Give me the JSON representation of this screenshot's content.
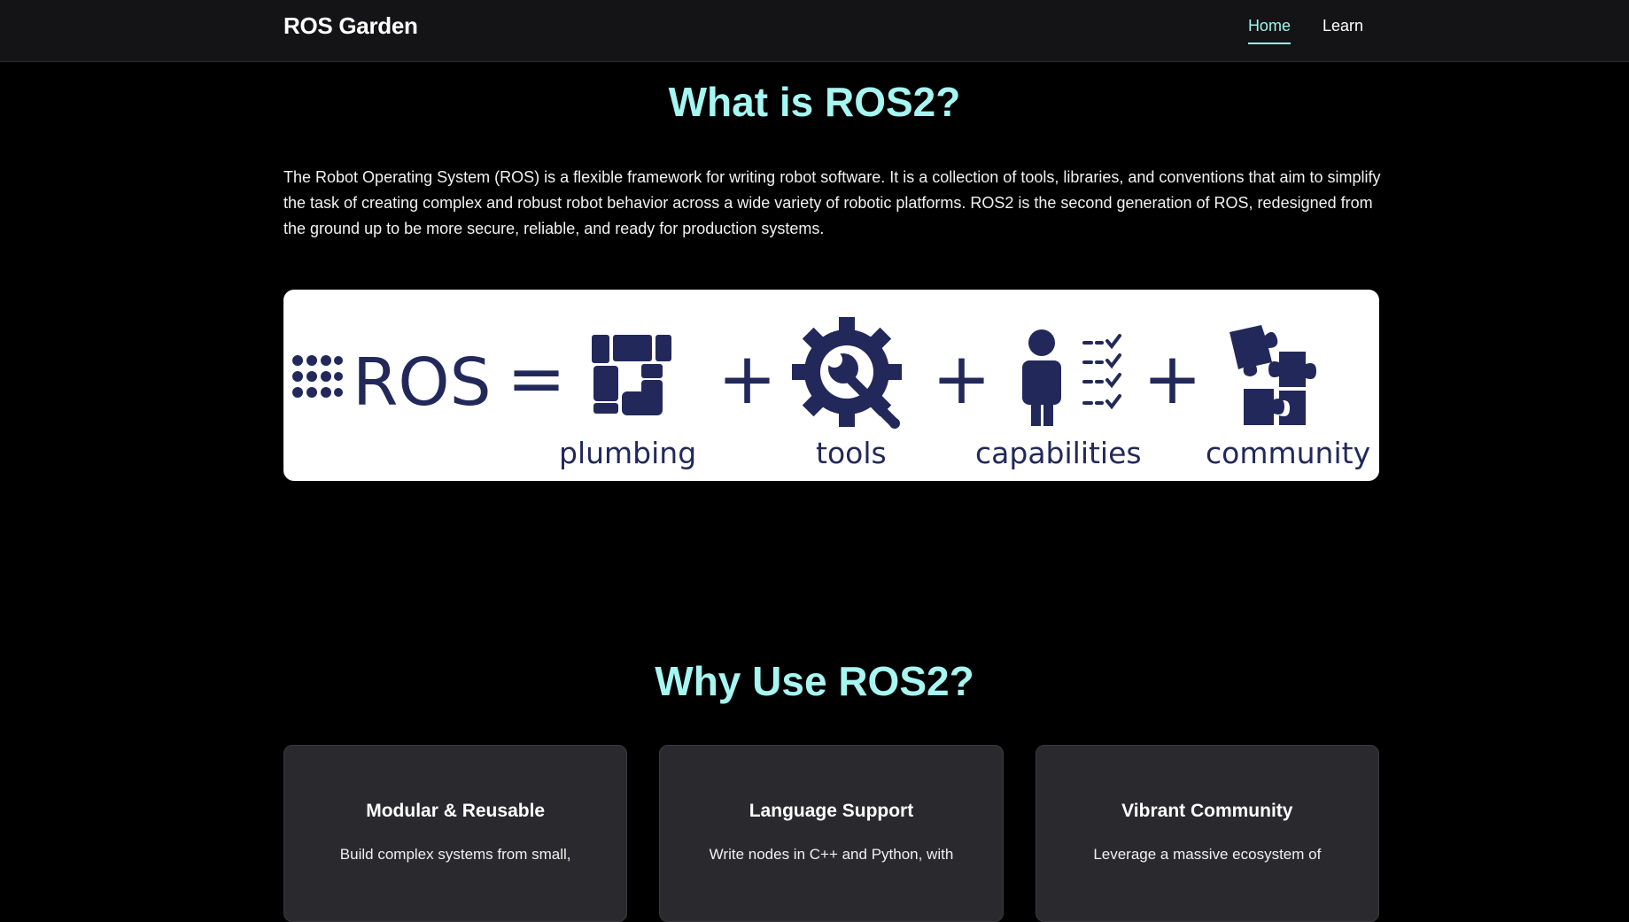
{
  "nav": {
    "brand": "ROS Garden",
    "links": [
      {
        "label": "Home",
        "active": true
      },
      {
        "label": "Learn",
        "active": false
      }
    ]
  },
  "what": {
    "title": "What is ROS2?",
    "paragraph": "The Robot Operating System (ROS) is a flexible framework for writing robot software. It is a collection of tools, libraries, and conventions that aim to simplify the task of creating complex and robust robot behavior across a wide variety of robotic platforms. ROS2 is the second generation of ROS, redesigned from the ground up to be more secure, reliable, and ready for production systems."
  },
  "banner": {
    "logo_text": "ROS",
    "equals": "=",
    "plus": "+",
    "labels": [
      "plumbing",
      "tools",
      "capabilities",
      "community"
    ],
    "ink_color": "#22295a"
  },
  "why": {
    "title": "Why Use ROS2?",
    "cards": [
      {
        "title": "Modular & Reusable",
        "desc": "Build complex systems from small,"
      },
      {
        "title": "Language Support",
        "desc": "Write nodes in C++ and Python, with"
      },
      {
        "title": "Vibrant Community",
        "desc": "Leverage a massive ecosystem of"
      }
    ]
  },
  "colors": {
    "accent": "#a6f6f2",
    "nav_bg": "#141416",
    "card_bg": "#2a2a2e",
    "page_bg": "#000000"
  }
}
